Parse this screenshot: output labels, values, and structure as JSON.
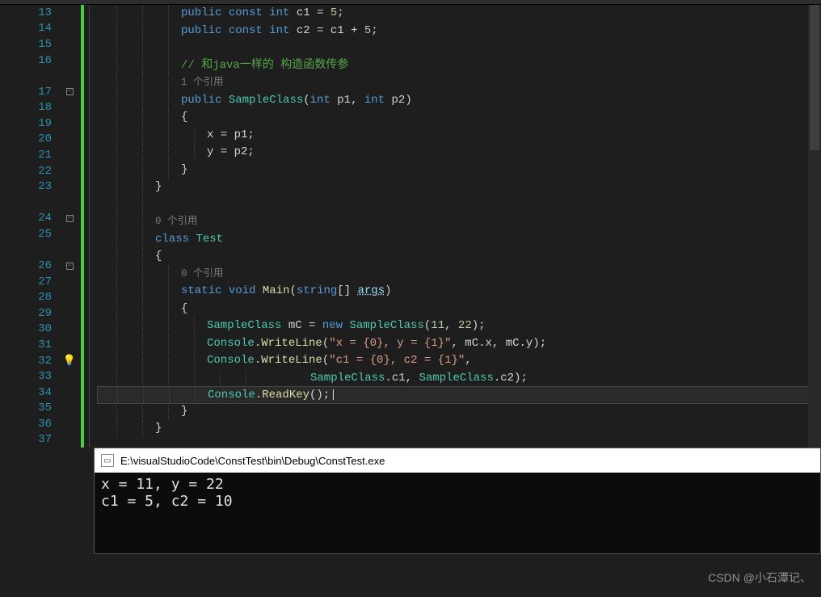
{
  "lines": [
    {
      "n": 13,
      "type": "code",
      "html": "<span class='kw'>public</span> <span class='kw'>const</span> <span class='kw'>int</span> c1 = <span class='num'>5</span>;",
      "indent": 3
    },
    {
      "n": 14,
      "type": "code",
      "html": "<span class='kw'>public</span> <span class='kw'>const</span> <span class='kw'>int</span> c2 = c1 + <span class='num'>5</span>;",
      "indent": 3
    },
    {
      "n": 15,
      "type": "code",
      "html": "",
      "indent": 3
    },
    {
      "n": 16,
      "type": "code",
      "html": "<span class='comment'>// 和java一样的 构造函数传参</span>",
      "indent": 3
    },
    {
      "n": "",
      "type": "ref",
      "html": "<span class='ref-line'>1 个引用</span>",
      "indent": 3
    },
    {
      "n": 17,
      "type": "code",
      "fold": true,
      "html": "<span class='kw'>public</span> <span class='type'>SampleClass</span>(<span class='kw'>int</span> p1, <span class='kw'>int</span> p2)",
      "indent": 3
    },
    {
      "n": 18,
      "type": "code",
      "html": "{",
      "indent": 3
    },
    {
      "n": 19,
      "type": "code",
      "html": "x = p1;",
      "indent": 4
    },
    {
      "n": 20,
      "type": "code",
      "html": "y = p2;",
      "indent": 4
    },
    {
      "n": 21,
      "type": "code",
      "html": "}",
      "indent": 3
    },
    {
      "n": 22,
      "type": "code",
      "html": "}",
      "indent": 2
    },
    {
      "n": 23,
      "type": "code",
      "html": "",
      "indent": 2
    },
    {
      "n": "",
      "type": "ref",
      "html": "<span class='ref-line'>0 个引用</span>",
      "indent": 2
    },
    {
      "n": 24,
      "type": "code",
      "fold": true,
      "html": "<span class='kw'>class</span> <span class='type'>Test</span>",
      "indent": 2
    },
    {
      "n": 25,
      "type": "code",
      "html": "{",
      "indent": 2
    },
    {
      "n": "",
      "type": "ref",
      "html": "<span class='ref-line'>0 个引用</span>",
      "indent": 3
    },
    {
      "n": 26,
      "type": "code",
      "fold": true,
      "html": "<span class='kw'>static</span> <span class='kw'>void</span> <span class='method'>Main</span>(<span class='kw'>string</span>[] <span class='param'>args</span>)",
      "indent": 3
    },
    {
      "n": 27,
      "type": "code",
      "html": "{",
      "indent": 3
    },
    {
      "n": 28,
      "type": "code",
      "html": "<span class='type'>SampleClass</span> mC = <span class='kw'>new</span> <span class='type'>SampleClass</span>(<span class='num'>11</span>, <span class='num'>22</span>);",
      "indent": 4
    },
    {
      "n": 29,
      "type": "code",
      "html": "<span class='type'>Console</span>.<span class='method'>WriteLine</span>(<span class='str'>\"x = {0}, y = {1}\"</span>, mC.x, mC.y);",
      "indent": 4
    },
    {
      "n": 30,
      "type": "code",
      "html": "<span class='type'>Console</span>.<span class='method'>WriteLine</span>(<span class='str'>\"c1 = {0}, c2 = {1}\"</span>,",
      "indent": 4
    },
    {
      "n": 31,
      "type": "code",
      "html": "<span class='type'>SampleClass</span>.c1, <span class='type'>SampleClass</span>.c2);",
      "indent": 8
    },
    {
      "n": 32,
      "type": "code",
      "bulb": true,
      "current": true,
      "html": "<span class='type'>Console</span>.<span class='method'>ReadKey</span>();|",
      "indent": 4
    },
    {
      "n": 33,
      "type": "code",
      "html": "}",
      "indent": 3
    },
    {
      "n": 34,
      "type": "code",
      "html": "}",
      "indent": 2
    },
    {
      "n": 35,
      "type": "code",
      "html": "",
      "indent": 0
    },
    {
      "n": 36,
      "type": "code",
      "html": "",
      "indent": 0
    },
    {
      "n": 37,
      "type": "code",
      "html": "",
      "indent": 0
    }
  ],
  "console": {
    "title": "E:\\visualStudioCode\\ConstTest\\bin\\Debug\\ConstTest.exe",
    "output": "x = 11, y = 22\nc1 = 5, c2 = 10"
  },
  "watermark": "CSDN @小石潭记、"
}
